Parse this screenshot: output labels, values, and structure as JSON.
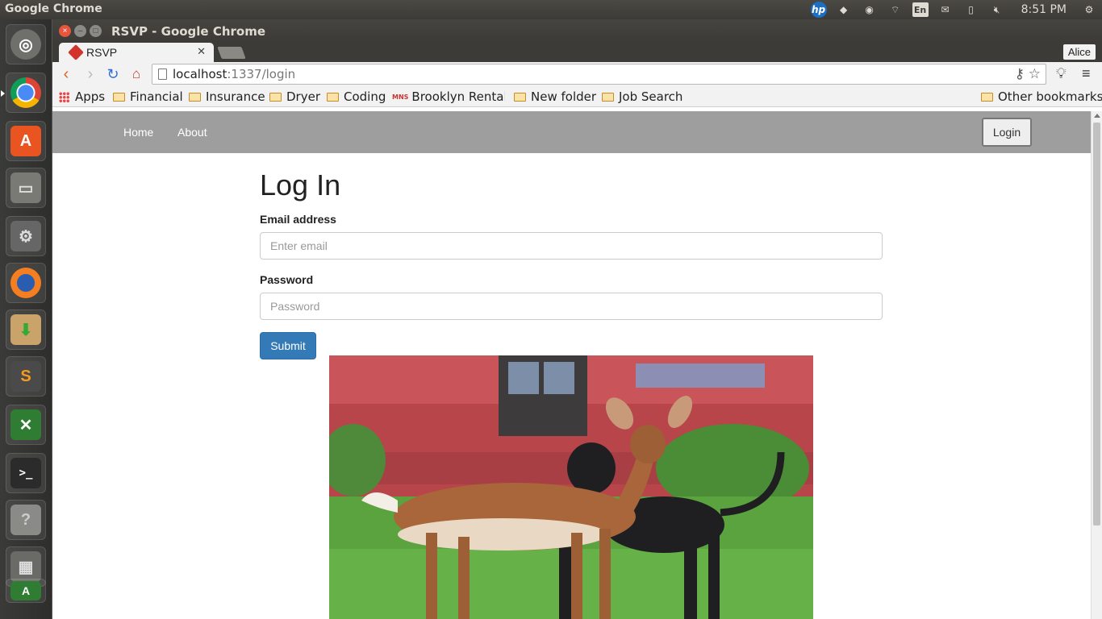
{
  "os": {
    "panel_app_name": "Google Chrome",
    "clock": "8:51 PM",
    "keyboard_layout": "En",
    "tray_icons": [
      "hp-icon",
      "dropbox-icon",
      "chrome-icon",
      "wifi-icon",
      "keyboard-icon",
      "mail-icon",
      "battery-icon",
      "volume-muted-icon",
      "settings-gear-icon"
    ],
    "launcher_items": [
      "ubuntu-dash",
      "google-chrome",
      "ubuntu-software-center",
      "files",
      "system-settings",
      "firefox",
      "archive-manager",
      "sublime-text",
      "xmind",
      "terminal",
      "help",
      "calculator",
      "disks"
    ]
  },
  "window": {
    "title": "RSVP - Google Chrome",
    "profile": "Alice",
    "tab_title": "RSVP"
  },
  "toolbar": {
    "url_host": "localhost",
    "url_rest": ":1337/login"
  },
  "bookmarks": {
    "apps": "Apps",
    "items": [
      "Financial",
      "Insurance",
      "Dryer",
      "Coding",
      "Brooklyn Rental",
      "New folder",
      "Job Search"
    ],
    "other": "Other bookmarks"
  },
  "page": {
    "nav": {
      "home": "Home",
      "about": "About",
      "login": "Login"
    },
    "heading": "Log In",
    "email_label": "Email address",
    "email_placeholder": "Enter email",
    "password_label": "Password",
    "password_placeholder": "Password",
    "submit_label": "Submit"
  },
  "colors": {
    "navbar": "#9e9e9e",
    "submit": "#337ab7",
    "ubuntu_panel": "#3c3b37"
  }
}
